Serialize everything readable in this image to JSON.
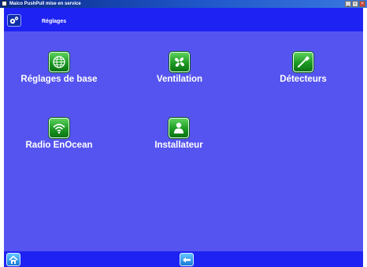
{
  "window": {
    "title": "Maico PushPull mise en service",
    "minimize_label": "_",
    "maximize_label": "▫",
    "close_label": "×"
  },
  "header": {
    "title": "Réglages"
  },
  "menu": {
    "items": [
      {
        "label": "Réglages de base",
        "icon": "globe-icon"
      },
      {
        "label": "Ventilation",
        "icon": "fan-icon"
      },
      {
        "label": "Détecteurs",
        "icon": "probe-icon"
      },
      {
        "label": "Radio EnOcean",
        "icon": "wifi-icon"
      },
      {
        "label": "Installateur",
        "icon": "user-icon"
      }
    ]
  },
  "footer": {
    "home_icon": "home-icon",
    "back_icon": "back-arrow-icon"
  },
  "colors": {
    "background": "#5554f0",
    "bars": "#1e22f2",
    "icon_green": "#1d9a24",
    "nav_blue": "#1a7ad8"
  }
}
